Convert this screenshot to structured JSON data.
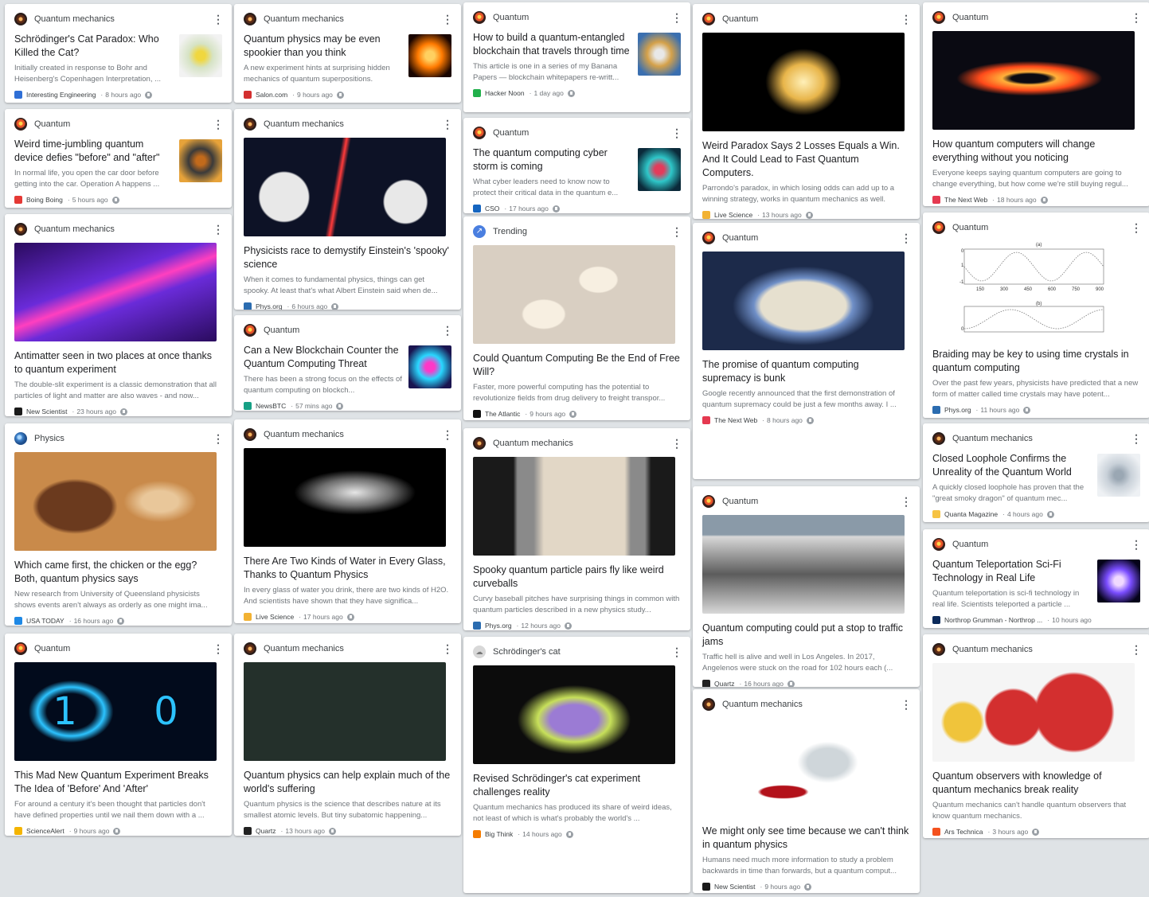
{
  "columns": [
    {
      "cards": [
        {
          "topic": "Quantum mechanics",
          "topic_icon": "quantum-mechanics-icon",
          "layout": "thumb",
          "title": "Schrödinger's Cat Paradox: Who Killed the Cat?",
          "snippet": "Initially created in response to Bohr and Heisenberg's Copenhagen Interpretation, ...",
          "source": "Interesting Engineering",
          "source_color": "#2f6fd6",
          "time": "8 hours ago",
          "image": "cat-paradox-diagram",
          "image_colors": [
            "#f2f2f2",
            "#d6e3c5",
            "#f0d73f"
          ]
        },
        {
          "topic": "Quantum",
          "topic_icon": "quantum-icon",
          "layout": "thumb",
          "title": "Weird time-jumbling quantum device defies \"before\" and \"after\"",
          "snippet": "In normal life, you open the car door before getting into the car. Operation A happens ...",
          "source": "Boing Boing",
          "source_color": "#e53935",
          "time": "5 hours ago",
          "image": "record-turntable",
          "image_colors": [
            "#e7a33a",
            "#3a3a3a",
            "#c26a1b"
          ]
        },
        {
          "topic": "Quantum mechanics",
          "topic_icon": "quantum-mechanics-icon",
          "layout": "hero",
          "title": "Antimatter seen in two places at once thanks to quantum experiment",
          "snippet": "The double-slit experiment is a classic demonstration that all particles of light and matter are also waves - and now...",
          "source": "New Scientist",
          "source_color": "#1a1a1a",
          "time": "23 hours ago",
          "image": "neon-corridor",
          "image_colors": [
            "#2a0b5e",
            "#ff3fbf",
            "#6a2bd9"
          ]
        },
        {
          "topic": "Physics",
          "topic_icon": "physics-icon",
          "layout": "hero",
          "title": "Which came first, the chicken or the egg? Both, quantum physics says",
          "snippet": "New research from University of Queensland physicists shows events aren't always as orderly as one might ima...",
          "source": "USA TODAY",
          "source_color": "#1e88e5",
          "time": "16 hours ago",
          "image": "chicken-and-eggs",
          "image_colors": [
            "#6b3a1e",
            "#c98a4a",
            "#e9c79a"
          ]
        },
        {
          "topic": "Quantum",
          "topic_icon": "quantum-icon",
          "layout": "hero",
          "title": "This Mad New Quantum Experiment Breaks The Idea of 'Before' And 'After'",
          "snippet": "For around a century it's been thought that particles don't have defined properties until we nail them down with a ...",
          "source": "ScienceAlert",
          "source_color": "#f4b400",
          "time": "9 hours ago",
          "image": "infinity-one-zero",
          "image_colors": [
            "#020b1c",
            "#2cc3ff",
            "#ffffff"
          ]
        }
      ]
    },
    {
      "cards": [
        {
          "topic": "Quantum mechanics",
          "topic_icon": "quantum-mechanics-icon",
          "layout": "thumb",
          "title": "Quantum physics may be even spookier than you think",
          "snippet": "A new experiment hints at surprising hidden mechanics of quantum superpositions.",
          "source": "Salon.com",
          "source_color": "#d32f2f",
          "time": "9 hours ago",
          "image": "spooky-burst",
          "image_colors": [
            "#1a0500",
            "#ff7a00",
            "#ffd060"
          ]
        },
        {
          "topic": "Quantum mechanics",
          "topic_icon": "quantum-mechanics-icon",
          "layout": "hero",
          "title": "Physicists race to demystify Einstein's 'spooky' science",
          "snippet": "When it comes to fundamental physics, things can get spooky. At least that's what Albert Einstein said when de...",
          "source": "Phys.org",
          "source_color": "#2b6cb0",
          "time": "6 hours ago",
          "image": "observatories-lasers",
          "image_colors": [
            "#0d1226",
            "#e8e8e8",
            "#ff3b3b"
          ]
        },
        {
          "topic": "Quantum",
          "topic_icon": "quantum-icon",
          "layout": "thumb",
          "title": "Can a New Blockchain Counter the Quantum Computing Threat",
          "snippet": "There has been a strong focus on the effects of quantum computing on blockch...",
          "source": "NewsBTC",
          "source_color": "#16a085",
          "time": "57 mins ago",
          "image": "circuit-chip",
          "image_colors": [
            "#1a1550",
            "#28d7ff",
            "#ff37c8"
          ]
        },
        {
          "topic": "Quantum mechanics",
          "topic_icon": "quantum-mechanics-icon",
          "layout": "hero",
          "title": "There Are Two Kinds of Water in Every Glass, Thanks to Quantum Physics",
          "snippet": "In every glass of water you drink, there are two kinds of H2O. And scientists have shown that they have significa...",
          "source": "Live Science",
          "source_color": "#f2b233",
          "time": "17 hours ago",
          "image": "water-splash",
          "image_colors": [
            "#000000",
            "#e6e6e6",
            "#6f6f6f"
          ]
        },
        {
          "topic": "Quantum mechanics",
          "topic_icon": "quantum-mechanics-icon",
          "layout": "hero",
          "title": "Quantum physics can help explain much of the world's suffering",
          "snippet": "Quantum physics is the science that describes nature at its smallest atomic levels. But tiny subatomic happening...",
          "source": "Quartz",
          "source_color": "#222222",
          "time": "13 hours ago",
          "image": "chalkboard-diagram",
          "image_colors": [
            "#24302b",
            "#d9d4c6",
            "#f3e6d3"
          ]
        }
      ]
    },
    {
      "cards": [
        {
          "topic": "Quantum",
          "topic_icon": "quantum-icon",
          "layout": "thumb",
          "title": "How to build a quantum-entangled blockchain that travels through time",
          "snippet": "This article is one in a series of my Banana Papers — blockchain whitepapers re-writt...",
          "source": "Hacker Noon",
          "source_color": "#21b04b",
          "time": "1 day ago",
          "image": "delorean-time",
          "image_colors": [
            "#3a6fb0",
            "#d4a14a",
            "#e8e8e8"
          ]
        },
        {
          "topic": "Quantum",
          "topic_icon": "quantum-icon",
          "layout": "thumb",
          "title": "The quantum computing cyber storm is coming",
          "snippet": "What cyber leaders need to know now to protect their critical data in the quantum e...",
          "source": "CSO",
          "source_color": "#1565c0",
          "time": "17 hours ago",
          "image": "cyber-grid",
          "image_colors": [
            "#0b2a3a",
            "#2ec7c9",
            "#e33b5b"
          ]
        },
        {
          "topic": "Trending",
          "topic_icon": "trending-icon",
          "layout": "hero",
          "title": "Could Quantum Computing Be the End of Free Will?",
          "snippet": "Faster, more powerful computing has the potential to revolutionize fields from drug delivery to freight transpor...",
          "source": "The Atlantic",
          "source_color": "#111111",
          "time": "9 hours ago",
          "image": "butterflies",
          "image_colors": [
            "#d9cfc2",
            "#f7efe1",
            "#2b2b2b"
          ]
        },
        {
          "topic": "Quantum mechanics",
          "topic_icon": "quantum-mechanics-icon",
          "layout": "hero",
          "title": "Spooky quantum particle pairs fly like weird curveballs",
          "snippet": "Curvy baseball pitches have surprising things in common with quantum particles described in a new physics study...",
          "source": "Phys.org",
          "source_color": "#2b6cb0",
          "time": "12 hours ago",
          "image": "lab-presenter",
          "image_colors": [
            "#1a1a1a",
            "#8a8a8a",
            "#e2d7c6"
          ]
        },
        {
          "topic": "Schrödinger's cat",
          "topic_icon": "cat-topic-icon",
          "layout": "hero",
          "title": "Revised Schrödinger's cat experiment challenges reality",
          "snippet": "Quantum mechanics has produced its share of weird ideas, not least of which is what's probably the world's ...",
          "source": "Big Think",
          "source_color": "#f57c00",
          "time": "14 hours ago",
          "image": "psychedelic-cat",
          "image_colors": [
            "#0c0c0c",
            "#9b7bd4",
            "#c7e05a"
          ]
        }
      ]
    },
    {
      "cards": [
        {
          "topic": "Quantum",
          "topic_icon": "quantum-icon",
          "layout": "hero",
          "title": "Weird Paradox Says 2 Losses Equals a Win. And It Could Lead to Fast Quantum Computers.",
          "snippet": "Parrondo's paradox, in which losing odds can add up to a winning strategy, works in quantum mechanics as well.",
          "source": "Live Science",
          "source_color": "#f2b233",
          "time": "13 hours ago",
          "image": "golden-smoke",
          "image_colors": [
            "#000000",
            "#e8b54a",
            "#fff0b8"
          ]
        },
        {
          "topic": "Quantum",
          "topic_icon": "quantum-icon",
          "layout": "hero",
          "title": "The promise of quantum computing supremacy is bunk",
          "snippet": "Google recently announced that the first demonstration of quantum supremacy could be just a few months away. I ...",
          "source": "The Next Web",
          "source_color": "#e53950",
          "time": "8 hours ago",
          "image": "retro-computer-space",
          "image_colors": [
            "#1c2a4a",
            "#e6e0cf",
            "#6f8fc7"
          ]
        },
        {
          "topic": "Quantum",
          "topic_icon": "quantum-icon",
          "layout": "hero",
          "title": "Quantum computing could put a stop to traffic jams",
          "snippet": "Traffic hell is alive and well in Los Angeles. In 2017, Angelenos were stuck on the road for 102 hours each (...",
          "source": "Quartz",
          "source_color": "#222222",
          "time": "16 hours ago",
          "image": "traffic-jam",
          "image_colors": [
            "#8a9aa8",
            "#5c5c5c",
            "#d8d8d8"
          ]
        },
        {
          "topic": "Quantum mechanics",
          "topic_icon": "quantum-mechanics-icon",
          "layout": "hero",
          "title": "We might only see time because we can't think in quantum physics",
          "snippet": "Humans need much more information to study a problem backwards in time than forwards, but a quantum comput...",
          "source": "New Scientist",
          "source_color": "#1a1a1a",
          "time": "9 hours ago",
          "image": "spilled-wine-glass",
          "image_colors": [
            "#ffffff",
            "#b3121b",
            "#cfd6da"
          ]
        }
      ]
    },
    {
      "cards": [
        {
          "topic": "Quantum",
          "topic_icon": "quantum-icon",
          "layout": "hero",
          "title": "How quantum computers will change everything without you noticing",
          "snippet": "Everyone keeps saying quantum computers are going to change everything, but how come we're still buying regul...",
          "source": "The Next Web",
          "source_color": "#e53950",
          "time": "18 hours ago",
          "image": "black-hole-disk",
          "image_colors": [
            "#0a0a12",
            "#ff4a1a",
            "#ffb03a"
          ]
        },
        {
          "topic": "Quantum",
          "topic_icon": "quantum-icon",
          "layout": "hero",
          "title": "Braiding may be key to using time crystals in quantum computing",
          "snippet": "Over the past few years, physicists have predicted that a new form of matter called time crystals may have potent...",
          "source": "Phys.org",
          "source_color": "#2b6cb0",
          "time": "11 hours ago",
          "image": "time-crystal-plot",
          "image_colors": [
            "#ffffff",
            "#6f6f6f",
            "#bdbdbd"
          ],
          "figure_labels": [
            "(a)",
            "(b)",
            "0",
            "1",
            "-1",
            "0",
            "150",
            "300",
            "450",
            "600",
            "750",
            "900"
          ]
        },
        {
          "topic": "Quantum mechanics",
          "topic_icon": "quantum-mechanics-icon",
          "layout": "thumb",
          "title": "Closed Loophole Confirms the Unreality of the Quantum World",
          "snippet": "A quickly closed loophole has proven that the \"great smoky dragon\" of quantum mec...",
          "source": "Quanta Magazine",
          "source_color": "#f6c344",
          "time": "4 hours ago",
          "image": "hanging-lamps",
          "image_colors": [
            "#eef1f4",
            "#c9d1d9",
            "#9aa7b3"
          ]
        },
        {
          "topic": "Quantum",
          "topic_icon": "quantum-icon",
          "layout": "thumb",
          "title": "Quantum Teleportation Sci-Fi Technology in Real Life",
          "snippet": "Quantum teleportation is sci-fi technology in real life. Scientists teleported a particle ...",
          "source": "Northrop Grumman - Northrop ...",
          "source_color": "#0b2a5b",
          "time": "10 hours ago",
          "image": "teleport-light",
          "image_colors": [
            "#05031a",
            "#7a4dff",
            "#f1d9ff"
          ]
        },
        {
          "topic": "Quantum mechanics",
          "topic_icon": "quantum-mechanics-icon",
          "layout": "hero",
          "title": "Quantum observers with knowledge of quantum mechanics break reality",
          "snippet": "Quantum mechanics can't handle quantum observers that know quantum mechanics.",
          "source": "Ars Technica",
          "source_color": "#f4511e",
          "time": "3 hours ago",
          "image": "nesting-dolls",
          "image_colors": [
            "#f5f5f5",
            "#d32f2f",
            "#f0c43b"
          ]
        }
      ]
    }
  ]
}
